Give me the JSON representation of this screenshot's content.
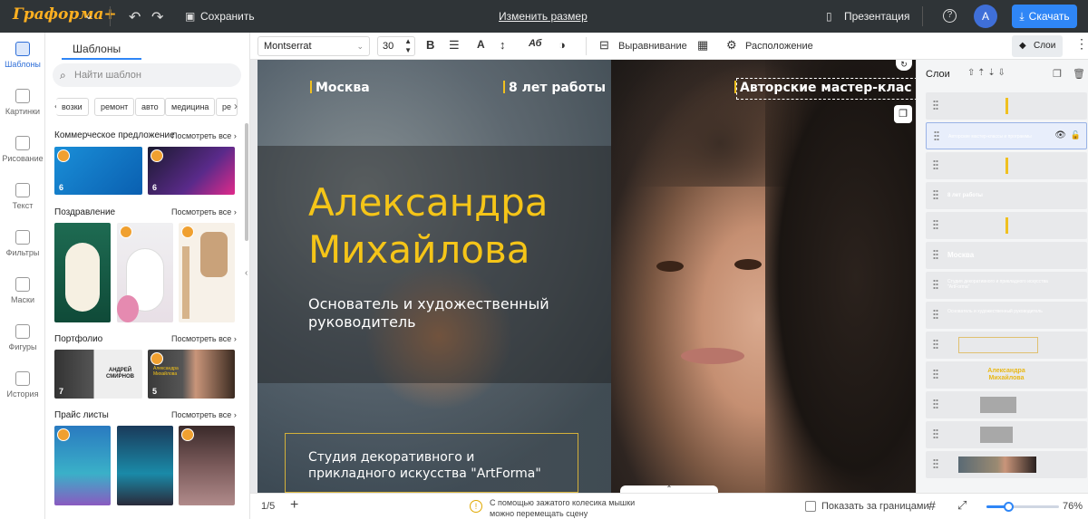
{
  "topbar": {
    "logo": "Граформа+",
    "save": "Сохранить",
    "resize": "Изменить размер",
    "presentation": "Презентация",
    "help_icon": "?",
    "avatar": "A",
    "download": "Скачать"
  },
  "leftnav": [
    {
      "label": "Шаблоны",
      "icon": "templates-icon",
      "active": true
    },
    {
      "label": "Картинки",
      "icon": "image-icon"
    },
    {
      "label": "Рисование",
      "icon": "pencil-icon"
    },
    {
      "label": "Текст",
      "icon": "text-icon"
    },
    {
      "label": "Фильтры",
      "icon": "filter-icon"
    },
    {
      "label": "Маски",
      "icon": "mask-icon"
    },
    {
      "label": "Фигуры",
      "icon": "shapes-icon"
    },
    {
      "label": "История",
      "icon": "history-icon"
    }
  ],
  "panel": {
    "tab": "Шаблоны",
    "search_placeholder": "Найти шаблон",
    "chips": [
      "возки",
      "ремонт",
      "авто",
      "медицина",
      "ре"
    ],
    "see_all": "Посмотреть все",
    "sections": [
      {
        "title": "Коммерческое предложение",
        "counts": [
          "6",
          "6"
        ]
      },
      {
        "title": "Поздравление"
      },
      {
        "title": "Портфолио",
        "counts": [
          "7",
          "5"
        ],
        "thumb_names": [
          "АНДРЕЙ СМИРНОВ",
          "Александра Михайлова"
        ]
      },
      {
        "title": "Прайс листы"
      }
    ]
  },
  "toolbar": {
    "font": "Montserrat",
    "size": "30",
    "bold": "B",
    "color_letter": "A",
    "case": "Аб",
    "align": "Выравнивание",
    "position": "Расположение",
    "layers": "Слои"
  },
  "canvas": {
    "city": "Москва",
    "years": "8 лет работы",
    "workshops": "Авторские мастер-клас",
    "name_line1": "Александра",
    "name_line2": "Михайлова",
    "role_line1": "Основатель и художественный",
    "role_line2": "руководитель",
    "studio_line1": "Студия декоративного  и",
    "studio_line2": "прикладного искусства \"ArtForma\""
  },
  "layers": {
    "title": "Слои",
    "rows": [
      {
        "kind": "bar"
      },
      {
        "kind": "text",
        "text": "Авторские мастер-классы и программы",
        "selected": true
      },
      {
        "kind": "bar"
      },
      {
        "kind": "text",
        "text": "8 лет работы"
      },
      {
        "kind": "bar"
      },
      {
        "kind": "text",
        "text": "Москва"
      },
      {
        "kind": "text",
        "text": "Студия декоративного и прикладного искусства \"ArtForma\""
      },
      {
        "kind": "text",
        "text": "Основатель и художественный руководитель"
      },
      {
        "kind": "frame"
      },
      {
        "kind": "name",
        "text": "Александра Михайлова"
      },
      {
        "kind": "gray"
      },
      {
        "kind": "gray"
      },
      {
        "kind": "photo"
      }
    ]
  },
  "bottombar": {
    "page": "1/5",
    "add": "+",
    "hint_line1": "С помощью зажатого колесика мышки",
    "hint_line2": "можно перемещать сцену",
    "show_outside": "Показать за границами",
    "zoom": "76%",
    "zoom_value": 0.3
  },
  "colors": {
    "accent": "#2f86f6",
    "gold": "#f5c518",
    "topbar": "#2f3437"
  }
}
